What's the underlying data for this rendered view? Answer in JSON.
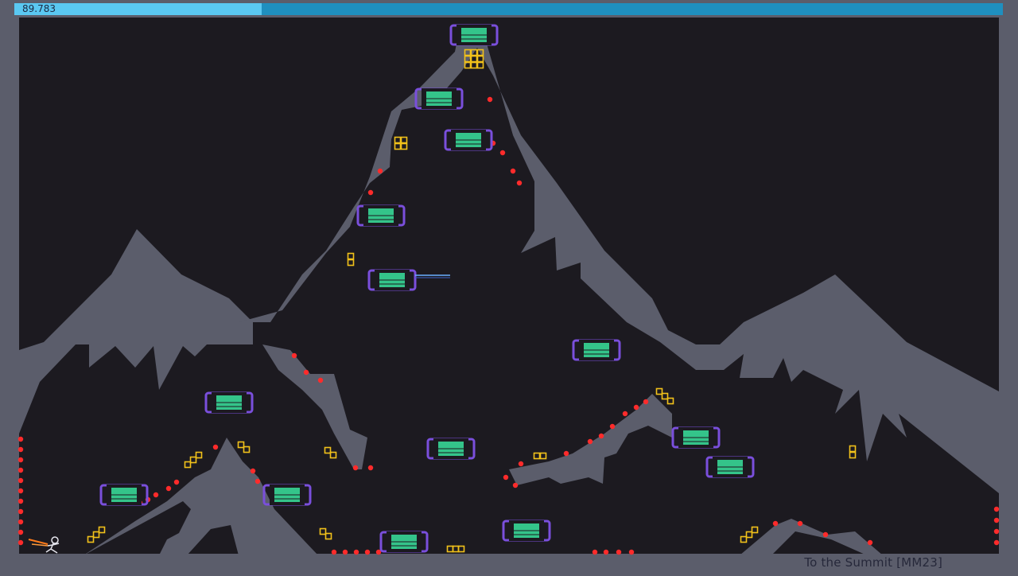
{
  "hud": {
    "time": "89.783",
    "time_fraction": 0.25,
    "level_name": "To the Summit [MM23]"
  },
  "colors": {
    "background": "#1c1a20",
    "terrain": "#5b5d6b",
    "mine": "#ff2b2b",
    "gold": "#f2c21a",
    "bounce_frame": "#7a4fdc",
    "bounce_block": "#34c48a",
    "timebar_fill": "#5ac8f2",
    "timebar_track": "#1f8fbf"
  },
  "entities": {
    "player": "ninja",
    "bounce_blocks": 17,
    "gold_clusters": 16
  }
}
